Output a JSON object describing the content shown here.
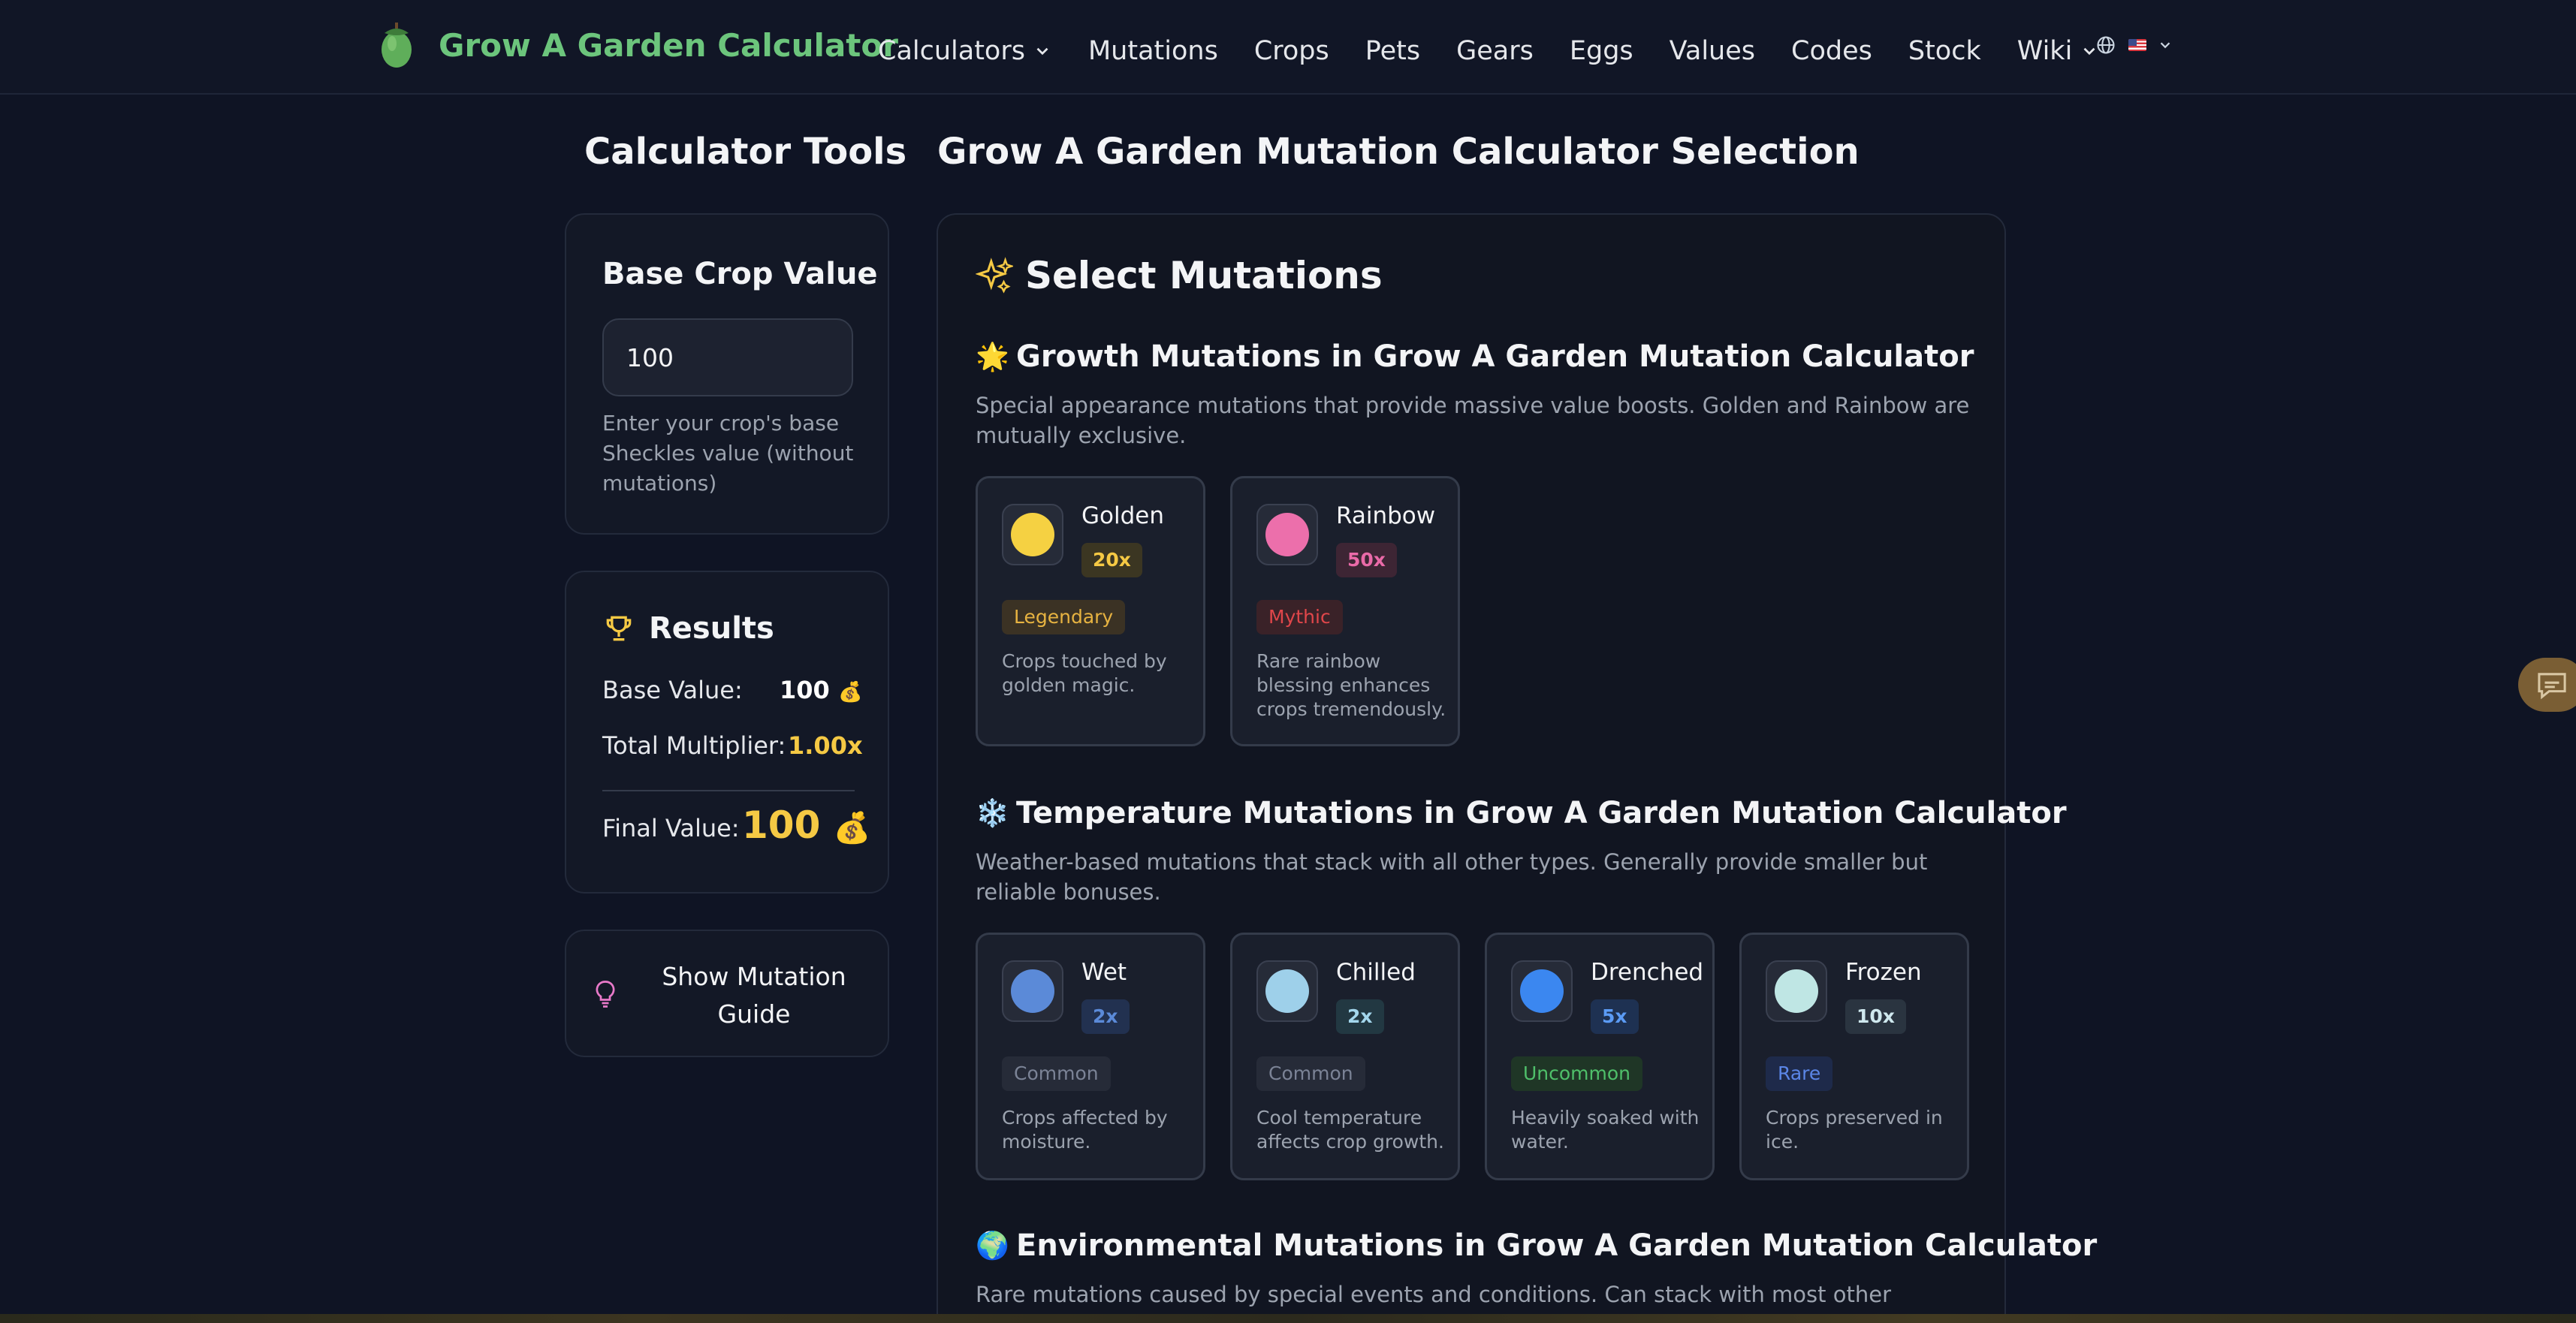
{
  "nav": {
    "brand": "Grow A Garden Calculator",
    "links": [
      {
        "label": "Calculators",
        "dropdown": true
      },
      {
        "label": "Mutations",
        "dropdown": false
      },
      {
        "label": "Crops",
        "dropdown": false
      },
      {
        "label": "Pets",
        "dropdown": false
      },
      {
        "label": "Gears",
        "dropdown": false
      },
      {
        "label": "Eggs",
        "dropdown": false
      },
      {
        "label": "Values",
        "dropdown": false
      },
      {
        "label": "Codes",
        "dropdown": false
      },
      {
        "label": "Stock",
        "dropdown": false
      },
      {
        "label": "Wiki",
        "dropdown": true
      }
    ],
    "language_icon": "globe-icon",
    "flag": "us-flag"
  },
  "sidebar": {
    "heading": "Calculator Tools",
    "base": {
      "title": "Base Crop Value",
      "value": "100",
      "help": "Enter your crop's base Sheckles value (without mutations)"
    },
    "results": {
      "title": "Results",
      "base_label": "Base Value:",
      "base_value": "100",
      "multiplier_label": "Total Multiplier:",
      "multiplier_value": "1.00x",
      "final_label": "Final Value:",
      "final_value": "100"
    },
    "guide_button": "Show Mutation Guide"
  },
  "main": {
    "heading": "Grow A Garden Mutation Calculator Selection",
    "panel_title": "Select Mutations",
    "sections": [
      {
        "emoji": "🌟",
        "title": "Growth Mutations in Grow A Garden Mutation Calculator",
        "description": "Special appearance mutations that provide massive value boosts. Golden and Rainbow are mutually exclusive.",
        "mutations": [
          {
            "name": "Golden",
            "multiplier": "20x",
            "rarity": "Legendary",
            "description": "Crops touched by golden magic.",
            "color": "#f5d142"
          },
          {
            "name": "Rainbow",
            "multiplier": "50x",
            "rarity": "Mythic",
            "description": "Rare rainbow blessing enhances crops tremendously.",
            "color": "#ec6fab"
          }
        ]
      },
      {
        "emoji": "❄️",
        "title": "Temperature Mutations in Grow A Garden Mutation Calculator",
        "description": "Weather-based mutations that stack with all other types. Generally provide smaller but reliable bonuses.",
        "mutations": [
          {
            "name": "Wet",
            "multiplier": "2x",
            "rarity": "Common",
            "description": "Crops affected by moisture.",
            "color": "#5b8ad8"
          },
          {
            "name": "Chilled",
            "multiplier": "2x",
            "rarity": "Common",
            "description": "Cool temperature affects crop growth.",
            "color": "#9ed0ea"
          },
          {
            "name": "Drenched",
            "multiplier": "5x",
            "rarity": "Uncommon",
            "description": "Heavily soaked with water.",
            "color": "#3b87f0"
          },
          {
            "name": "Frozen",
            "multiplier": "10x",
            "rarity": "Rare",
            "description": "Crops preserved in ice.",
            "color": "#bfe6e4"
          }
        ]
      },
      {
        "emoji": "🌍",
        "title": "Environmental Mutations in Grow A Garden Mutation Calculator",
        "description": "Rare mutations caused by special events and conditions. Can stack with most other mutations for massive gains."
      }
    ]
  },
  "colors": {
    "brand": "#6cc57c",
    "gold": "#f5c944",
    "background": "#0f1424"
  }
}
